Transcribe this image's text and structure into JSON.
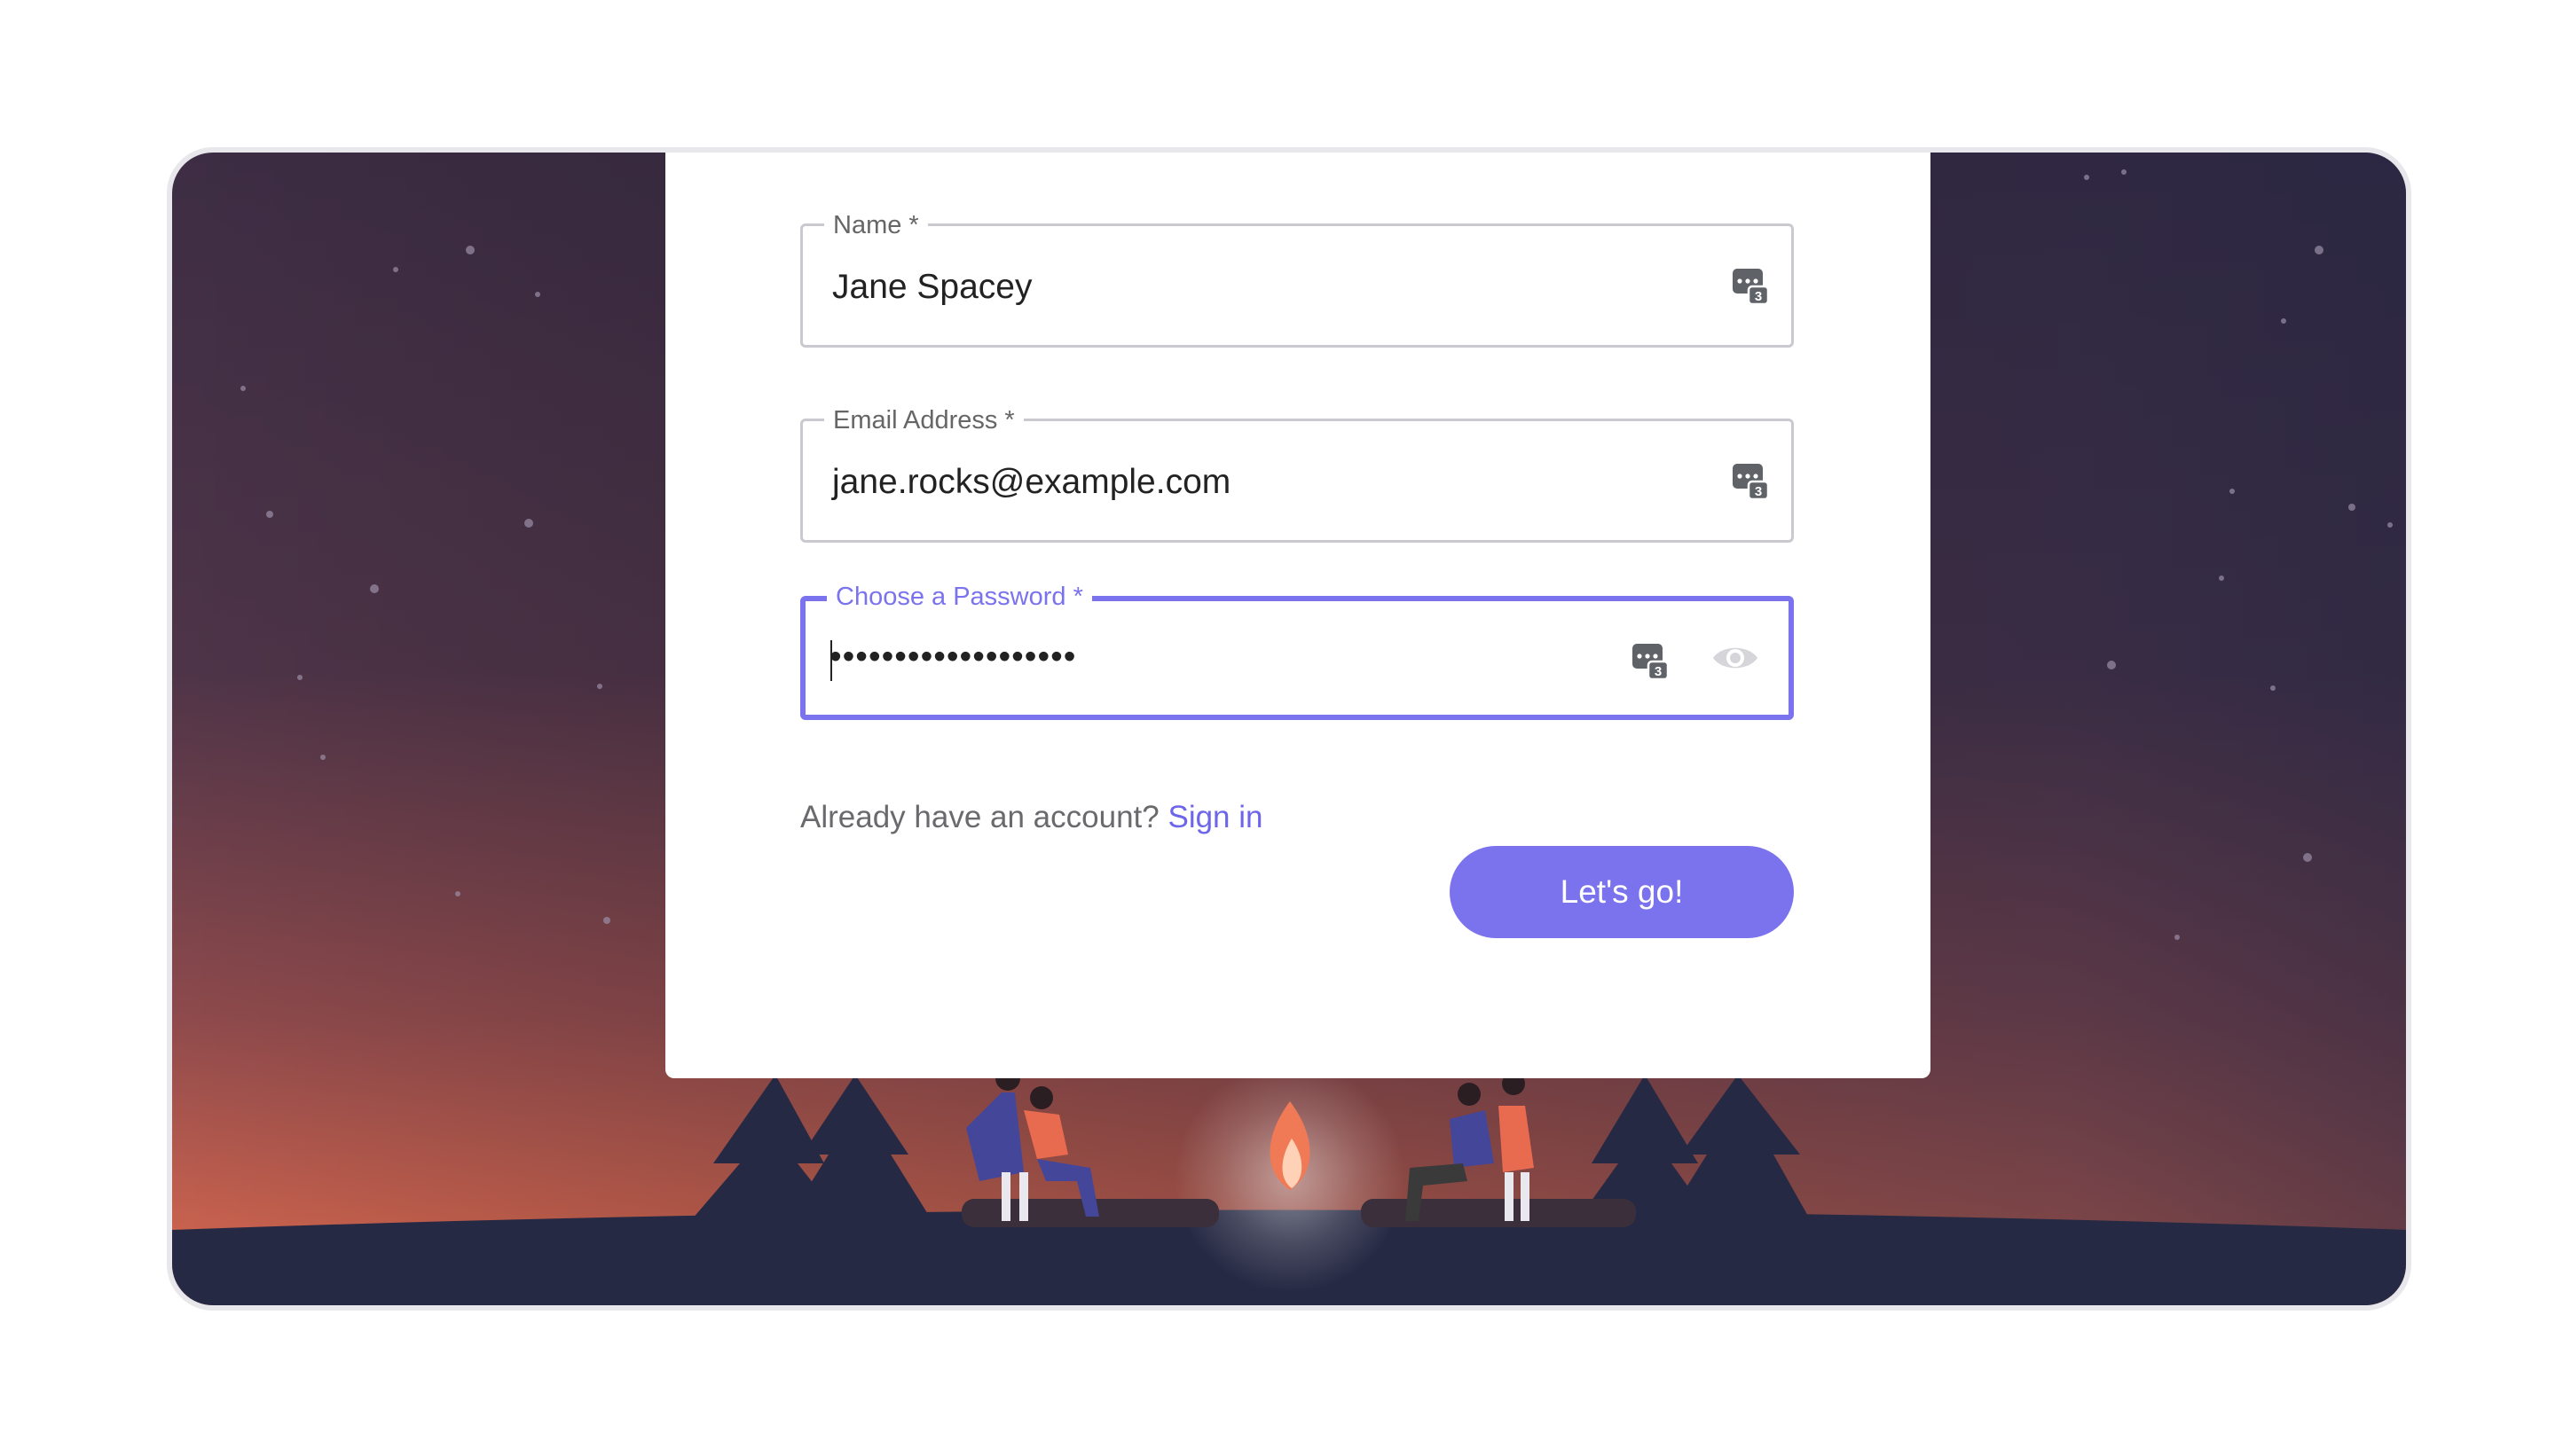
{
  "form": {
    "name_field": {
      "label": "Name *",
      "value": "Jane Spacey"
    },
    "email_field": {
      "label": "Email Address *",
      "value": "jane.rocks@example.com"
    },
    "password_field": {
      "label": "Choose a Password *",
      "value": "•••••••••••••••••••"
    },
    "account_prompt": "Already have an account?",
    "sign_in_link": "Sign in",
    "submit_label": "Let's go!"
  },
  "icons": {
    "password_manager": "password-manager-icon",
    "show_password": "eye-icon"
  },
  "colors": {
    "accent": "#7b73ee",
    "sky_top": "#3b2d45",
    "sky_bottom": "#d8674f",
    "ground": "#262943"
  }
}
